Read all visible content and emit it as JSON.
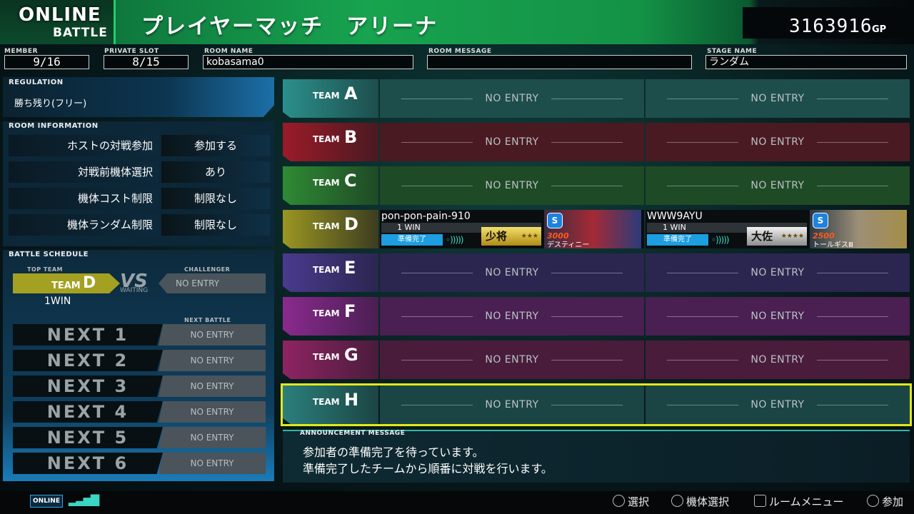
{
  "header": {
    "mode_line1": "ONLINE",
    "mode_line2": "BATTLE",
    "title": "プレイヤーマッチ　アリーナ",
    "gp_value": "3163916",
    "gp_unit": "GP"
  },
  "info": {
    "member_label": "MEMBER",
    "member_value": "9/16",
    "private_slot_label": "PRIVATE SLOT",
    "private_slot_value": "8/15",
    "room_name_label": "ROOM NAME",
    "room_name_value": "kobasama0",
    "room_message_label": "ROOM MESSAGE",
    "room_message_value": "",
    "stage_name_label": "STAGE NAME",
    "stage_name_value": "ランダム"
  },
  "regulation": {
    "label": "REGULATION",
    "value": "勝ち残り(フリー)"
  },
  "room_information": {
    "label": "ROOM INFORMATION",
    "rows": [
      {
        "label": "ホストの対戦参加",
        "value": "参加する"
      },
      {
        "label": "対戦前機体選択",
        "value": "あり"
      },
      {
        "label": "機体コスト制限",
        "value": "制限なし"
      },
      {
        "label": "機体ランダム制限",
        "value": "制限なし"
      }
    ]
  },
  "battle_schedule": {
    "label": "BATTLE SCHEDULE",
    "top_team_label": "TOP TEAM",
    "challenger_label": "CHALLENGER",
    "top_team_word": "TEAM",
    "top_team_letter": "D",
    "top_team_wins": "1WIN",
    "vs": "VS",
    "waiting": "WAITING",
    "challenger_value": "NO ENTRY",
    "next_battle_label": "NEXT BATTLE",
    "next": [
      {
        "label": "NEXT 1",
        "value": "NO ENTRY"
      },
      {
        "label": "NEXT 2",
        "value": "NO ENTRY"
      },
      {
        "label": "NEXT 3",
        "value": "NO ENTRY"
      },
      {
        "label": "NEXT 4",
        "value": "NO ENTRY"
      },
      {
        "label": "NEXT 5",
        "value": "NO ENTRY"
      },
      {
        "label": "NEXT 6",
        "value": "NO ENTRY"
      }
    ]
  },
  "teams": [
    {
      "word": "TEAM",
      "letter": "A",
      "color": "#2b8f8c",
      "slot_color": "#1d4e4c",
      "slot1": "NO ENTRY",
      "slot2": "NO ENTRY"
    },
    {
      "word": "TEAM",
      "letter": "B",
      "color": "#9b1b28",
      "slot_color": "#4a1a22",
      "slot1": "NO ENTRY",
      "slot2": "NO ENTRY"
    },
    {
      "word": "TEAM",
      "letter": "C",
      "color": "#2f8a34",
      "slot_color": "#1f4a26",
      "slot1": "NO ENTRY",
      "slot2": "NO ENTRY"
    },
    {
      "word": "TEAM",
      "letter": "D",
      "color": "#9b9623",
      "slot_color": "#3c3d20",
      "players": [
        {
          "name": "pon-pon-pain-910",
          "wins": "1 WIN",
          "ready": "準備完了",
          "rank": "少将",
          "rank_style": "gold",
          "stars": "★★★",
          "badge": "S",
          "cost": "3000",
          "unit": "デスティニー"
        },
        {
          "name": "WWW9AYU",
          "wins": "1 WIN",
          "ready": "準備完了",
          "rank": "大佐",
          "rank_style": "silver",
          "stars": "★★★★",
          "badge": "S",
          "cost": "2500",
          "unit": "トールギスⅢ"
        }
      ]
    },
    {
      "word": "TEAM",
      "letter": "E",
      "color": "#4a3a8e",
      "slot_color": "#2b2650",
      "slot1": "NO ENTRY",
      "slot2": "NO ENTRY"
    },
    {
      "word": "TEAM",
      "letter": "F",
      "color": "#8a2a8e",
      "slot_color": "#4a1f52",
      "slot1": "NO ENTRY",
      "slot2": "NO ENTRY"
    },
    {
      "word": "TEAM",
      "letter": "G",
      "color": "#8e2462",
      "slot_color": "#4a1c3c",
      "slot1": "NO ENTRY",
      "slot2": "NO ENTRY"
    },
    {
      "word": "TEAM",
      "letter": "H",
      "color": "#2b7f7c",
      "slot_color": "#1b4544",
      "slot1": "NO ENTRY",
      "slot2": "NO ENTRY"
    }
  ],
  "announcement": {
    "label": "ANNOUNCEMENT MESSAGE",
    "line1": "参加者の準備完了を待っています。",
    "line2": "準備完了したチームから順番に対戦を行います。"
  },
  "status": {
    "online_badge": "ONLINE",
    "signal": "▂▃▅▇"
  },
  "controls": [
    {
      "glyph": "stick",
      "label": "選択"
    },
    {
      "glyph": "triangle",
      "label": "機体選択"
    },
    {
      "glyph": "square",
      "label": "ルームメニュー"
    },
    {
      "glyph": "circle",
      "label": "参加"
    }
  ]
}
